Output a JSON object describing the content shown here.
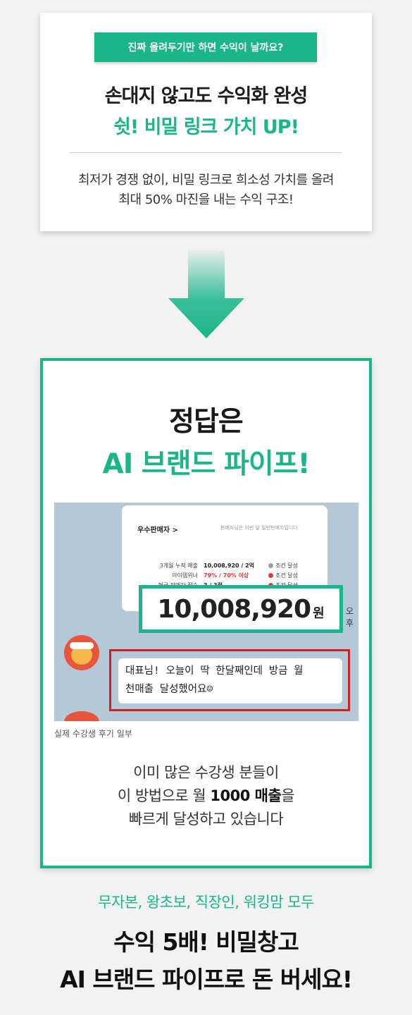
{
  "intro": {
    "badge": "진짜 올려두기만 하면 수익이 날까요?",
    "headline": "손대지 않고도 수익화 완성",
    "headline_accent": "쉿! 비밀 링크 가치 UP!",
    "desc_line1": "최저가 경쟁 없이, 비밀 링크로 희소성 가치를 올려",
    "desc_line2": "최대 50% 마진을 내는 수익 구조!"
  },
  "answer": {
    "title": "정답은",
    "title_accent": "AI 브랜드 파이프!",
    "screenshot": {
      "panel_title": "우수판매자 >",
      "panel_sub": "판매자님은 이번 달 일반판매자입니다.",
      "rows": [
        {
          "label": "3개월 누적 매출",
          "value": "10,008,920 / 2억",
          "status": "조건 달성"
        },
        {
          "label": "아이템위너",
          "value": "79% / 70% 이상",
          "status": "조건 달성"
        },
        {
          "label": "평균 판매자 점수",
          "value": "3 / 3점",
          "status": "조건 달성"
        }
      ],
      "amount": "10,008,920",
      "amount_unit": "원",
      "side_text": "오후",
      "message_line1": "대표님! 오늘이 딱 한달째인데 방금 월",
      "message_line2": "천매출 달성했어요☺"
    },
    "caption": "실제 수강생 후기 일부",
    "desc_line1": "이미 많은 수강생 분들이",
    "desc_line2_pre": "이 방법으로 월 ",
    "desc_line2_bold": "1000 매출",
    "desc_line2_post": "을",
    "desc_line3": "빠르게 달성하고 있습니다"
  },
  "footer": {
    "subtitle": "무자본, 왕초보, 직장인, 워킹맘 모두",
    "headline1": "수익 5배! 비밀창고",
    "headline2": "AI 브랜드 파이프로 돈 버세요!"
  },
  "colors": {
    "accent": "#1bb58a",
    "highlight_red": "#d32020"
  }
}
